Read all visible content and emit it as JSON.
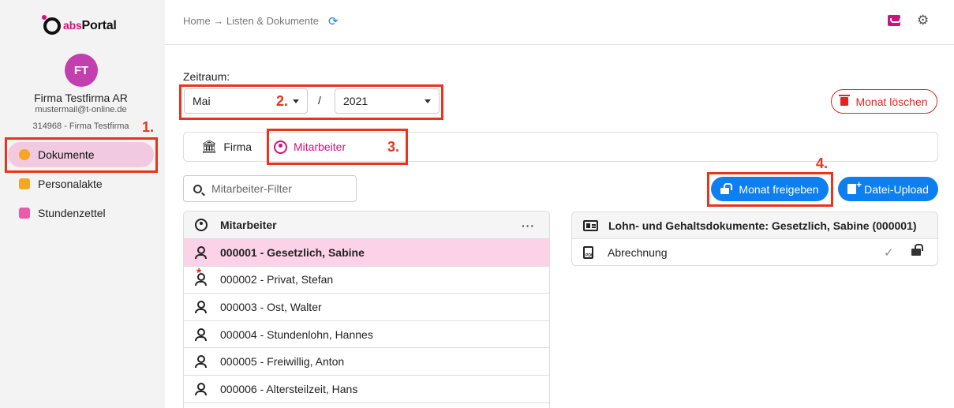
{
  "app": {
    "logo_abs": "abs",
    "logo_portal": "Portal"
  },
  "user": {
    "initials": "FT",
    "company": "Firma Testfirma AR",
    "email": "mustermail@t-online.de",
    "client": "314968 - Firma Testfirma"
  },
  "sidebar": {
    "items": [
      {
        "label": "Dokumente",
        "icon": "person-icon",
        "color": "#f5a623",
        "active": true
      },
      {
        "label": "Personalakte",
        "icon": "briefcase-icon",
        "color": "#f5a623",
        "active": false
      },
      {
        "label": "Stundenzettel",
        "icon": "calendar-icon",
        "color": "#e95aa8",
        "active": false
      }
    ]
  },
  "header": {
    "breadcrumb": "Home → Listen & Dokumente",
    "refresh_icon": "refresh-icon",
    "mail_icon": "mail-icon",
    "settings_icon": "gear-icon"
  },
  "period": {
    "label": "Zeitraum:",
    "month": "Mai",
    "separator": "/",
    "year": "2021"
  },
  "actions": {
    "delete_month": "Monat löschen",
    "release_month": "Monat freigeben",
    "upload": "Datei-Upload"
  },
  "tabs": [
    {
      "label": "Firma",
      "icon": "bank-icon"
    },
    {
      "label": "Mitarbeiter",
      "icon": "user-circle-icon",
      "active": true
    }
  ],
  "filter": {
    "placeholder": "Mitarbeiter-Filter"
  },
  "employees": {
    "header": "Mitarbeiter",
    "menu": "···",
    "rows": [
      {
        "label": "000001 - Gesetzlich, Sabine",
        "selected": true
      },
      {
        "label": "000002 - Privat, Stefan",
        "marked": true
      },
      {
        "label": "000003 - Ost, Walter"
      },
      {
        "label": "000004 - Stundenlohn, Hannes"
      },
      {
        "label": "000005 - Freiwillig, Anton"
      },
      {
        "label": "000006 - Altersteilzeit, Hans"
      }
    ]
  },
  "documents": {
    "header": "Lohn- und Gehaltsdokumente: Gesetzlich, Sabine (000001)",
    "rows": [
      {
        "label": "Abrechnung",
        "type": "pdf"
      }
    ]
  },
  "annotations": {
    "step1": "1.",
    "step2": "2.",
    "step3": "3.",
    "step4": "4.",
    "color": "#e8341c"
  },
  "colors": {
    "brand": "#d0127e",
    "primary": "#0d7ff0",
    "danger": "#e02424"
  }
}
